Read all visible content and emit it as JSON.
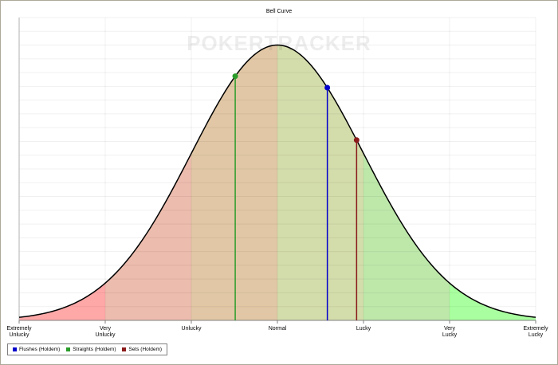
{
  "chart_data": {
    "type": "area",
    "title": "Bell Curve",
    "watermark": "POKERTRACKER",
    "xlabel": "",
    "ylabel": "",
    "xlim": [
      -3,
      3
    ],
    "ylim": [
      0,
      1.1
    ],
    "grid": true,
    "legend_position": "bottom-left",
    "curve": {
      "shape": "normal",
      "mean": 0,
      "sd": 1,
      "color": "#000000"
    },
    "ticks": [
      {
        "x": -3,
        "label": "Extremely\nUnlucky"
      },
      {
        "x": -2,
        "label": "Very\nUnlucky"
      },
      {
        "x": -1,
        "label": "Unlucky"
      },
      {
        "x": 0,
        "label": "Normal"
      },
      {
        "x": 1,
        "label": "Lucky"
      },
      {
        "x": 2,
        "label": "Very\nLucky"
      },
      {
        "x": 3,
        "label": "Extremely\nLucky"
      }
    ],
    "bands": [
      {
        "from": -3,
        "to": -2,
        "color": "#ffa8a8"
      },
      {
        "from": -2,
        "to": -1,
        "color": "#ecbcae"
      },
      {
        "from": -1,
        "to": 0,
        "color": "#e1c7a5"
      },
      {
        "from": 0,
        "to": 1,
        "color": "#d3dcab"
      },
      {
        "from": 1,
        "to": 2,
        "color": "#bde8aa"
      },
      {
        "from": 2,
        "to": 3,
        "color": "#a9ff9f"
      }
    ],
    "series": [
      {
        "name": "Flushes (Holdem)",
        "x": 0.58,
        "color": "#0000cc"
      },
      {
        "name": "Straights (Holdem)",
        "x": -0.49,
        "color": "#2a9c2a"
      },
      {
        "name": "Sets (Holdem)",
        "x": 0.92,
        "color": "#8b1a1a"
      }
    ]
  }
}
